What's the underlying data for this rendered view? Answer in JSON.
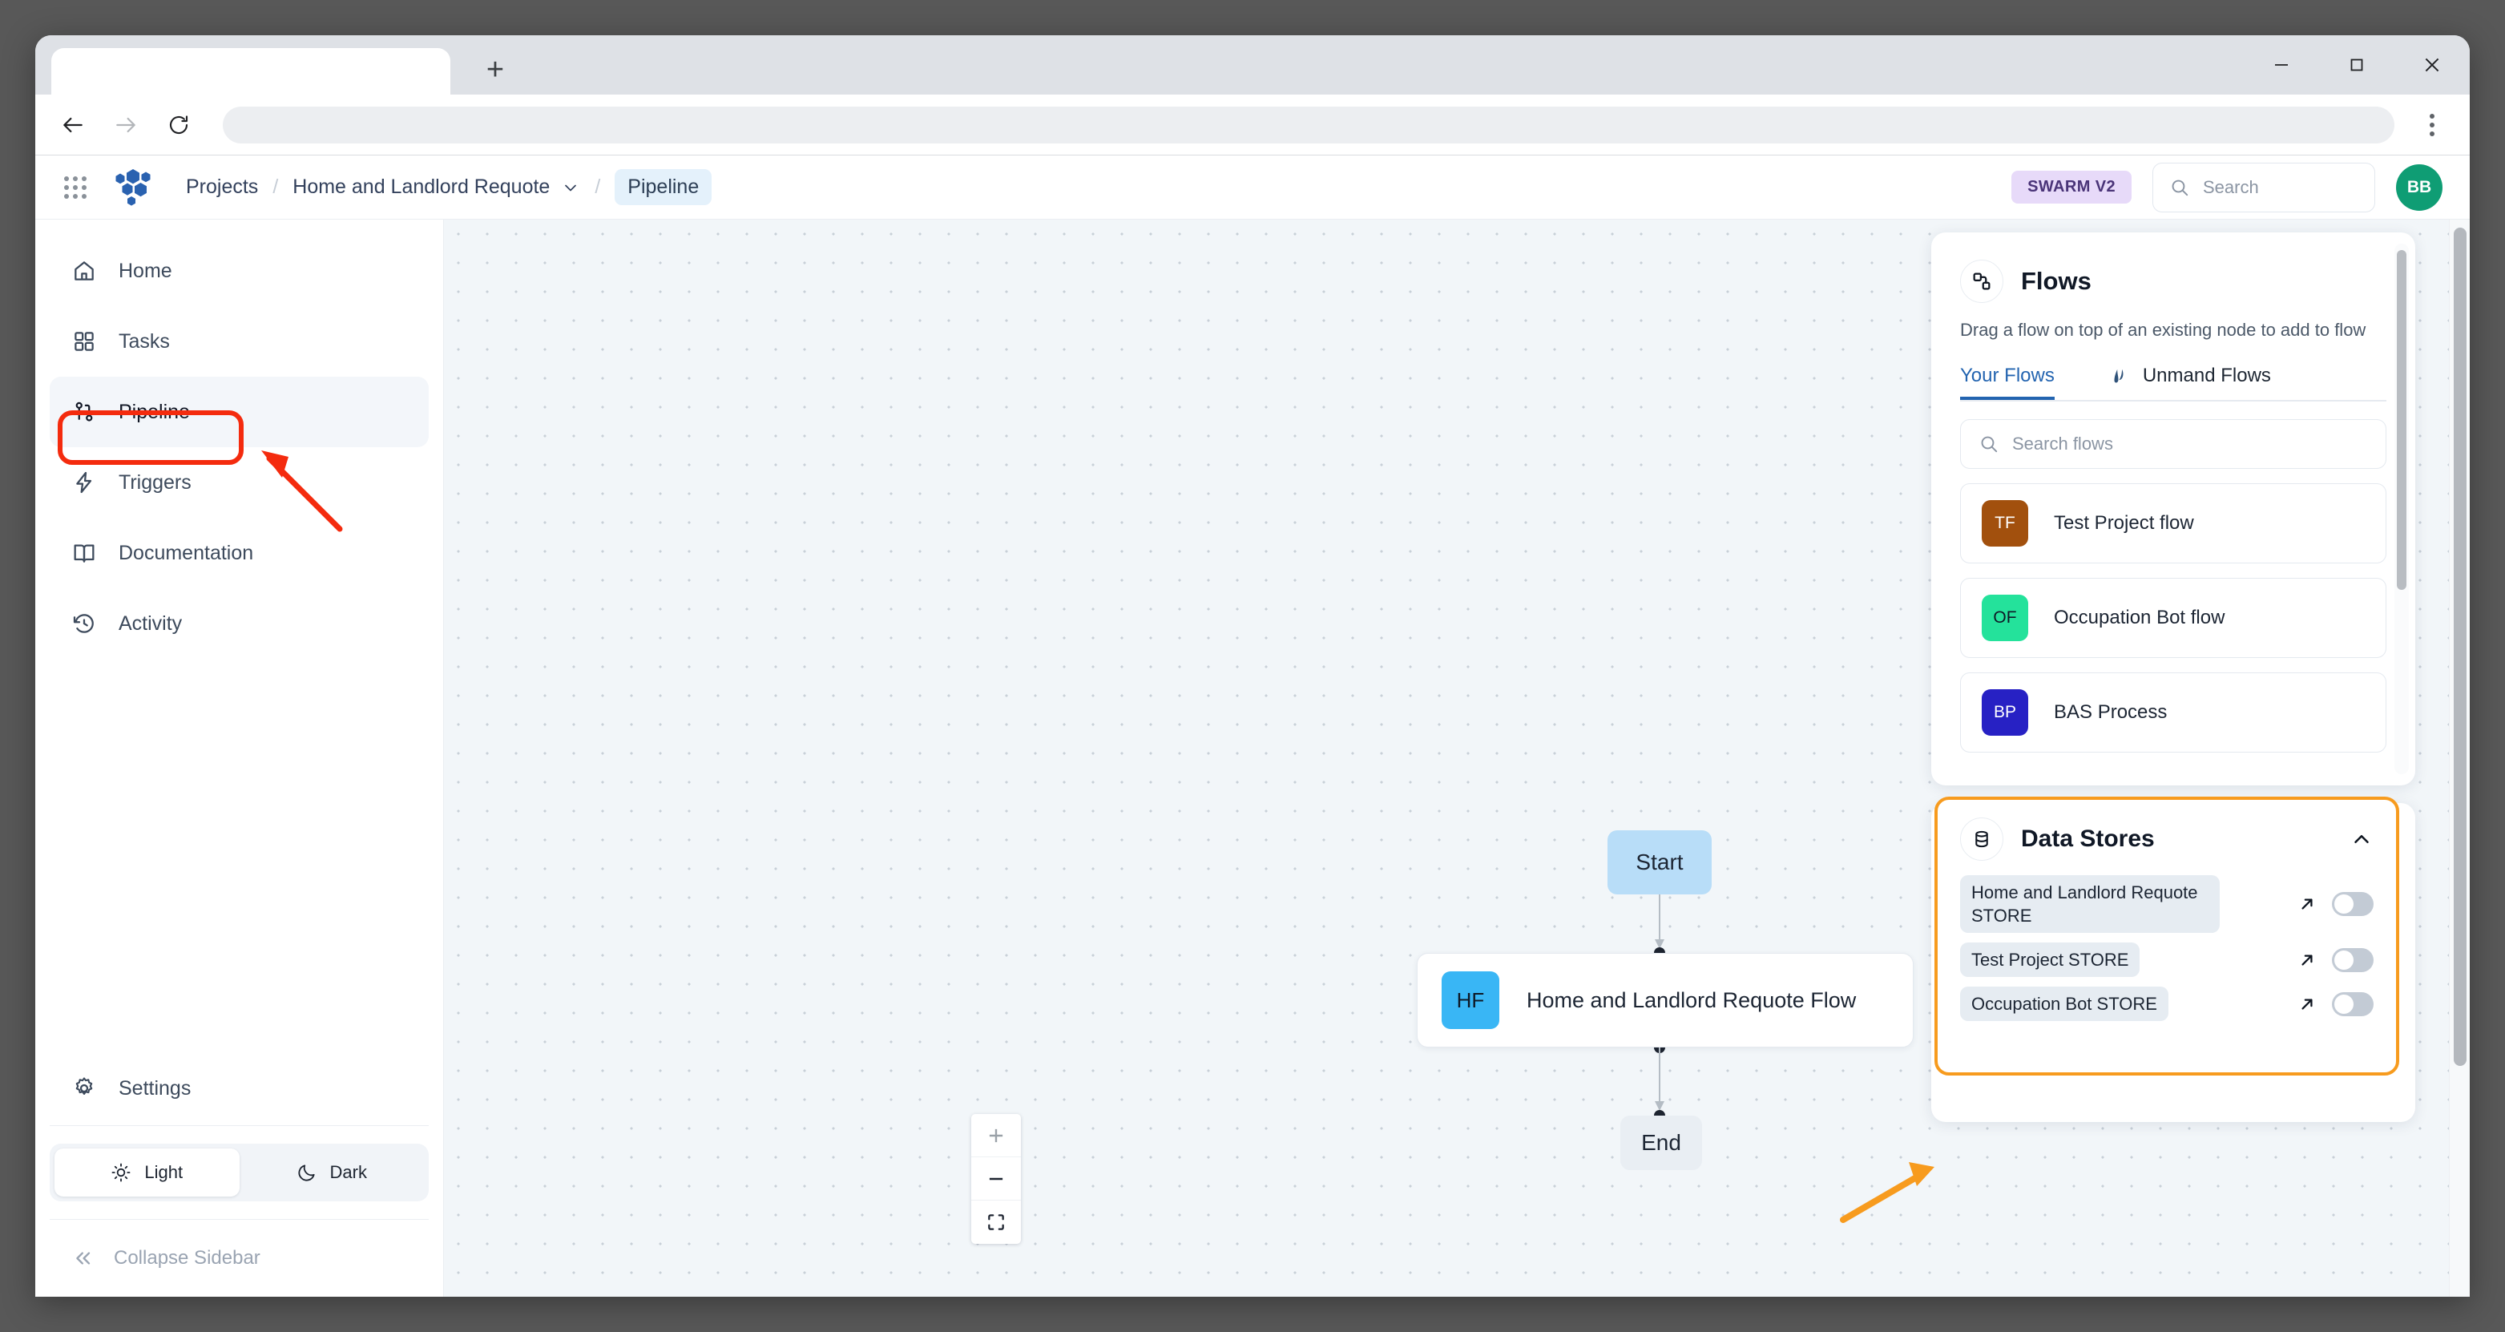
{
  "browser": {
    "tab_title": "",
    "new_tab_label": "+",
    "url_value": "",
    "url_placeholder": "",
    "back_icon": "arrow-left-icon",
    "forward_icon": "arrow-right-icon",
    "reload_icon": "reload-icon",
    "menu_icon": "kebab-menu-icon",
    "minimize_label": "minimize-icon",
    "maximize_label": "maximize-icon",
    "close_label": "close-icon"
  },
  "header": {
    "apps_grid_icon": "apps-grid-icon",
    "brand_logo_icon": "hexagon-cluster-logo",
    "breadcrumb": [
      {
        "label": "Projects",
        "type": "link"
      },
      {
        "label": "Home and Landlord Requote",
        "type": "dropdown"
      },
      {
        "label": "Pipeline",
        "type": "current"
      }
    ],
    "separator": "/",
    "swarm_badge": "SWARM V2",
    "search": {
      "placeholder": "Search",
      "value": "",
      "icon": "search-icon"
    },
    "avatar_initials": "BB",
    "avatar_color": "#0f9d74"
  },
  "sidebar": {
    "items": [
      {
        "label": "Home",
        "icon": "home-icon",
        "active": false
      },
      {
        "label": "Tasks",
        "icon": "grid-squares-icon",
        "active": false
      },
      {
        "label": "Pipeline",
        "icon": "pipeline-branch-icon",
        "active": true
      },
      {
        "label": "Triggers",
        "icon": "lightning-bolt-icon",
        "active": false
      },
      {
        "label": "Documentation",
        "icon": "open-book-icon",
        "active": false
      },
      {
        "label": "Activity",
        "icon": "history-clock-icon",
        "active": false
      }
    ],
    "settings": {
      "label": "Settings",
      "icon": "gear-icon"
    },
    "theme": {
      "options": [
        {
          "label": "Light",
          "icon": "sun-icon",
          "selected": true
        },
        {
          "label": "Dark",
          "icon": "moon-icon",
          "selected": false
        }
      ]
    },
    "collapse": {
      "label": "Collapse Sidebar",
      "icon": "chevron-double-left-icon"
    }
  },
  "canvas": {
    "nodes": {
      "start": {
        "label": "Start",
        "color": "#b8ddf8"
      },
      "flow": {
        "label": "Home and Landlord Requote Flow",
        "badge": "HF",
        "badge_color": "#39b6f5"
      },
      "end": {
        "label": "End",
        "color": "#e9eef3"
      }
    },
    "zoom_controls": [
      {
        "label": "+",
        "name": "zoom-in-button"
      },
      {
        "label": "–",
        "name": "zoom-out-button"
      },
      {
        "label": "fit",
        "name": "fit-view-button"
      }
    ]
  },
  "flows_panel": {
    "icon": "flow-nodes-icon",
    "title": "Flows",
    "subtitle": "Drag a flow on top of an existing node to add to flow",
    "tabs": [
      {
        "label": "Your Flows",
        "selected": true
      },
      {
        "label": "Unmand Flows",
        "selected": false,
        "icon": "unmand-leaf-logo"
      }
    ],
    "search": {
      "placeholder": "Search flows",
      "value": "",
      "icon": "search-icon"
    },
    "flows": [
      {
        "initials": "TF",
        "name": "Test Project flow",
        "color": "#a2500d"
      },
      {
        "initials": "OF",
        "name": "Occupation Bot flow",
        "color": "#24e29b"
      },
      {
        "initials": "BP",
        "name": "BAS Process",
        "color": "#2721c4"
      }
    ]
  },
  "data_stores_panel": {
    "icon": "database-icon",
    "title": "Data Stores",
    "collapse_icon": "chevron-up-icon",
    "highlight_color": "#f79b1e",
    "stores": [
      {
        "name": "Home and Landlord Requote STORE",
        "open_icon": "external-link-icon",
        "enabled": false
      },
      {
        "name": "Test Project STORE",
        "open_icon": "external-link-icon",
        "enabled": false
      },
      {
        "name": "Occupation Bot STORE",
        "open_icon": "external-link-icon",
        "enabled": false
      }
    ]
  },
  "annotations": {
    "pipeline_highlight_color": "#f42b0e",
    "pipeline_arrow_color": "#f42b0e",
    "datastore_arrow_color": "#f79b1e"
  }
}
